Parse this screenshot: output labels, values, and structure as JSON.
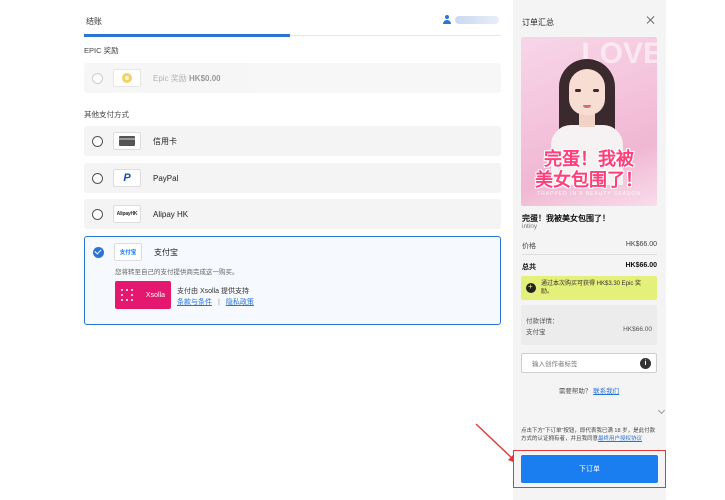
{
  "checkout": {
    "tab_label": "结账",
    "epic_section_label": "EPIC 奖励",
    "epic_reward": {
      "label": "Epic 奖励",
      "amount": "HK$0.00"
    },
    "other_methods_label": "其他支付方式",
    "methods": [
      {
        "label": "信用卡",
        "icon": "credit-card-icon"
      },
      {
        "label": "PayPal",
        "icon": "paypal-icon",
        "icon_glyph": "P"
      },
      {
        "label": "Alipay HK",
        "icon": "alipay-hk-icon",
        "icon_glyph": "AlipayHK"
      }
    ],
    "selected_method": {
      "label": "支付宝",
      "icon_glyph": "支付宝",
      "redirect_note": "您将转至自己的支付提供商完成这一购买。",
      "xsolla_logo_text": "Xsolla",
      "xsolla_text": "支付由 Xsolla 提供支持",
      "terms_link": "条款与条件",
      "privacy_link": "隐私政策"
    }
  },
  "summary": {
    "title": "订单汇总",
    "cover_bg_text": "LOVE",
    "cover_title_line1": "完蛋！我被",
    "cover_title_line2": "美女包围了！",
    "cover_sub": "TRAPPED IN A BEAUTY SEASON",
    "game_title": "完蛋！我被美女包围了！",
    "developer": "intiny",
    "price_label": "价格",
    "price_value": "HK$66.00",
    "total_label": "总共",
    "total_value": "HK$66.00",
    "reward_text": "通过本次购买可获得 HK$3.30 Epic 奖励。",
    "details_title": "付款详情：",
    "details_method": "支付宝",
    "details_value": "HK$66.00",
    "creator_tag_placeholder": "输入创作者标签",
    "help_text": "需要帮助？",
    "help_link": "联系我们",
    "legal_text": "点击下方\"下订单\"按钮，即代表我已满 18 岁，是此付款方式的认证拥有者，并且我同意",
    "legal_link": "最终用户授权协议",
    "order_button": "下订单"
  },
  "colors": {
    "accent": "#2a74d8",
    "order_button": "#1a7df0",
    "reward_bg": "#e4f07a",
    "highlight_frame": "#e23a3a"
  }
}
